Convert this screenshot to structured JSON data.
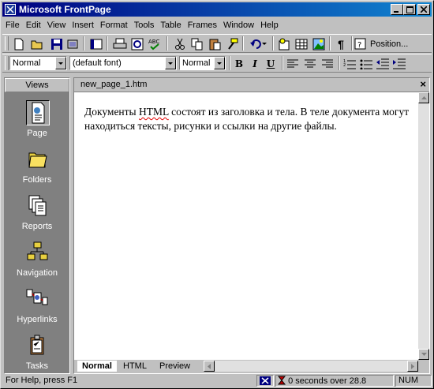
{
  "window": {
    "title": "Microsoft FrontPage"
  },
  "menu": [
    "File",
    "Edit",
    "View",
    "Insert",
    "Format",
    "Tools",
    "Table",
    "Frames",
    "Window",
    "Help"
  ],
  "toolbar": {
    "position_label": "Position..."
  },
  "format_bar": {
    "style": "Normal",
    "font": "(default font)",
    "size": "Normal"
  },
  "views": {
    "header": "Views",
    "items": [
      {
        "label": "Page",
        "icon": "page-icon"
      },
      {
        "label": "Folders",
        "icon": "folders-icon"
      },
      {
        "label": "Reports",
        "icon": "reports-icon"
      },
      {
        "label": "Navigation",
        "icon": "navigation-icon"
      },
      {
        "label": "Hyperlinks",
        "icon": "hyperlinks-icon"
      },
      {
        "label": "Tasks",
        "icon": "tasks-icon"
      }
    ]
  },
  "document": {
    "tab_name": "new_page_1.htm",
    "text_before": "Документы ",
    "text_squiggle": "HTML",
    "text_after": " состоят из заголовка и тела. В теле документа могут находиться тексты, рисунки и ссылки на другие файлы."
  },
  "view_tabs": [
    "Normal",
    "HTML",
    "Preview"
  ],
  "status": {
    "help": "For Help, press F1",
    "timing": "0 seconds over 28.8",
    "num": "NUM"
  }
}
